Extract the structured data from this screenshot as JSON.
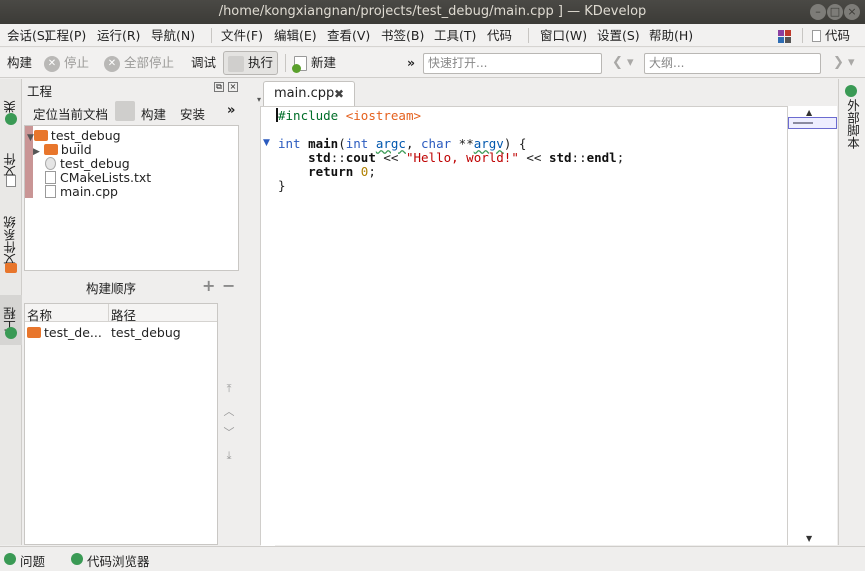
{
  "window": {
    "title": "/home/kongxiangnan/projects/test_debug/main.cpp ] — KDevelop"
  },
  "menu": [
    "会话(S)",
    "工程(P)",
    "运行(R)",
    "导航(N)",
    "文件(F)",
    "编辑(E)",
    "查看(V)",
    "书签(B)",
    "工具(T)",
    "代码",
    "窗口(W)",
    "设置(S)",
    "帮助(H)"
  ],
  "menu_right": {
    "label": "代码"
  },
  "toolbar": {
    "build": "构建",
    "stop": "停止",
    "stop_all": "全部停止",
    "debug": "调试",
    "execute": "执行",
    "new": "新建",
    "more": "»",
    "quick_open_placeholder": "快速打开...",
    "outline_placeholder": "大纲..."
  },
  "left_tabs": {
    "classes": "类",
    "documents": "文件",
    "filesystem": "文件系统",
    "projects": "工程"
  },
  "right_tabs": {
    "scripts": "外部脚本"
  },
  "project_panel": {
    "title": "工程",
    "locate": "定位当前文档",
    "build": "构建",
    "install": "安装",
    "more": "»",
    "tree": [
      {
        "label": "test_debug",
        "kind": "folder"
      },
      {
        "label": "build",
        "kind": "folder"
      },
      {
        "label": "test_debug",
        "kind": "exec"
      },
      {
        "label": "CMakeLists.txt",
        "kind": "file"
      },
      {
        "label": "main.cpp",
        "kind": "file"
      }
    ]
  },
  "build_order": {
    "title": "构建顺序",
    "columns": [
      "名称",
      "路径"
    ],
    "rows": [
      {
        "name": "test_de...",
        "path": "test_debug"
      }
    ]
  },
  "editor": {
    "tab_label": "main.cpp",
    "close_glyph": "✖"
  },
  "statusbar": {
    "problems": "问题",
    "code_browser": "代码浏览器"
  },
  "colors": {
    "accent": "#e8762c",
    "keyword": "#2b5bbf",
    "string": "#bf0303"
  }
}
